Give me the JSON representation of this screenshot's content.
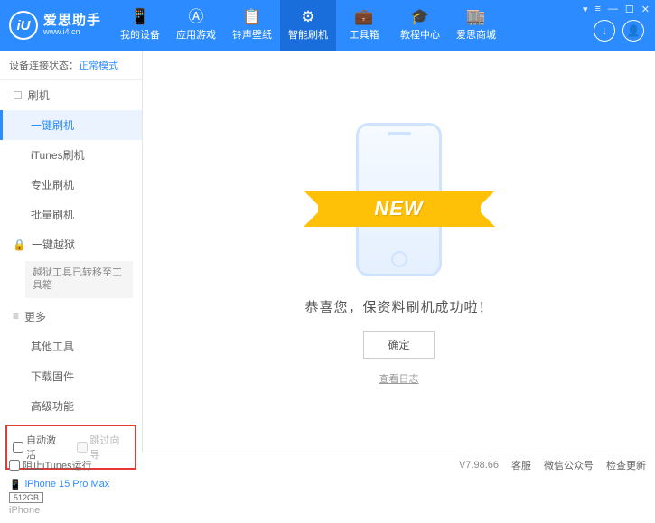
{
  "header": {
    "logo_letter": "iU",
    "title": "爱思助手",
    "url": "www.i4.cn",
    "nav": [
      {
        "label": "我的设备",
        "icon": "📱"
      },
      {
        "label": "应用游戏",
        "icon": "Ⓐ"
      },
      {
        "label": "铃声壁纸",
        "icon": "📋"
      },
      {
        "label": "智能刷机",
        "icon": "⚙"
      },
      {
        "label": "工具箱",
        "icon": "💼"
      },
      {
        "label": "教程中心",
        "icon": "🎓"
      },
      {
        "label": "爱思商城",
        "icon": "🏬"
      }
    ]
  },
  "sidebar": {
    "status_label": "设备连接状态：",
    "status_value": "正常模式",
    "sections": {
      "flash": {
        "icon": "☐",
        "title": "刷机"
      },
      "jailbreak": {
        "icon": "🔒",
        "title": "一键越狱"
      },
      "more": {
        "icon": "≡",
        "title": "更多"
      }
    },
    "flash_items": [
      "一键刷机",
      "iTunes刷机",
      "专业刷机",
      "批量刷机"
    ],
    "jailbreak_note": "越狱工具已转移至工具箱",
    "more_items": [
      "其他工具",
      "下载固件",
      "高级功能"
    ],
    "checks": {
      "auto_activate": "自动激活",
      "skip_guide": "跳过向导"
    },
    "device": {
      "name": "iPhone 15 Pro Max",
      "storage": "512GB",
      "type": "iPhone",
      "icon": "📱"
    }
  },
  "main": {
    "ribbon": "NEW",
    "success_text": "恭喜您，保资料刷机成功啦！",
    "ok_button": "确定",
    "log_link": "查看日志"
  },
  "footer": {
    "block_itunes": "阻止iTunes运行",
    "version": "V7.98.66",
    "links": [
      "客服",
      "微信公众号",
      "检查更新"
    ]
  }
}
